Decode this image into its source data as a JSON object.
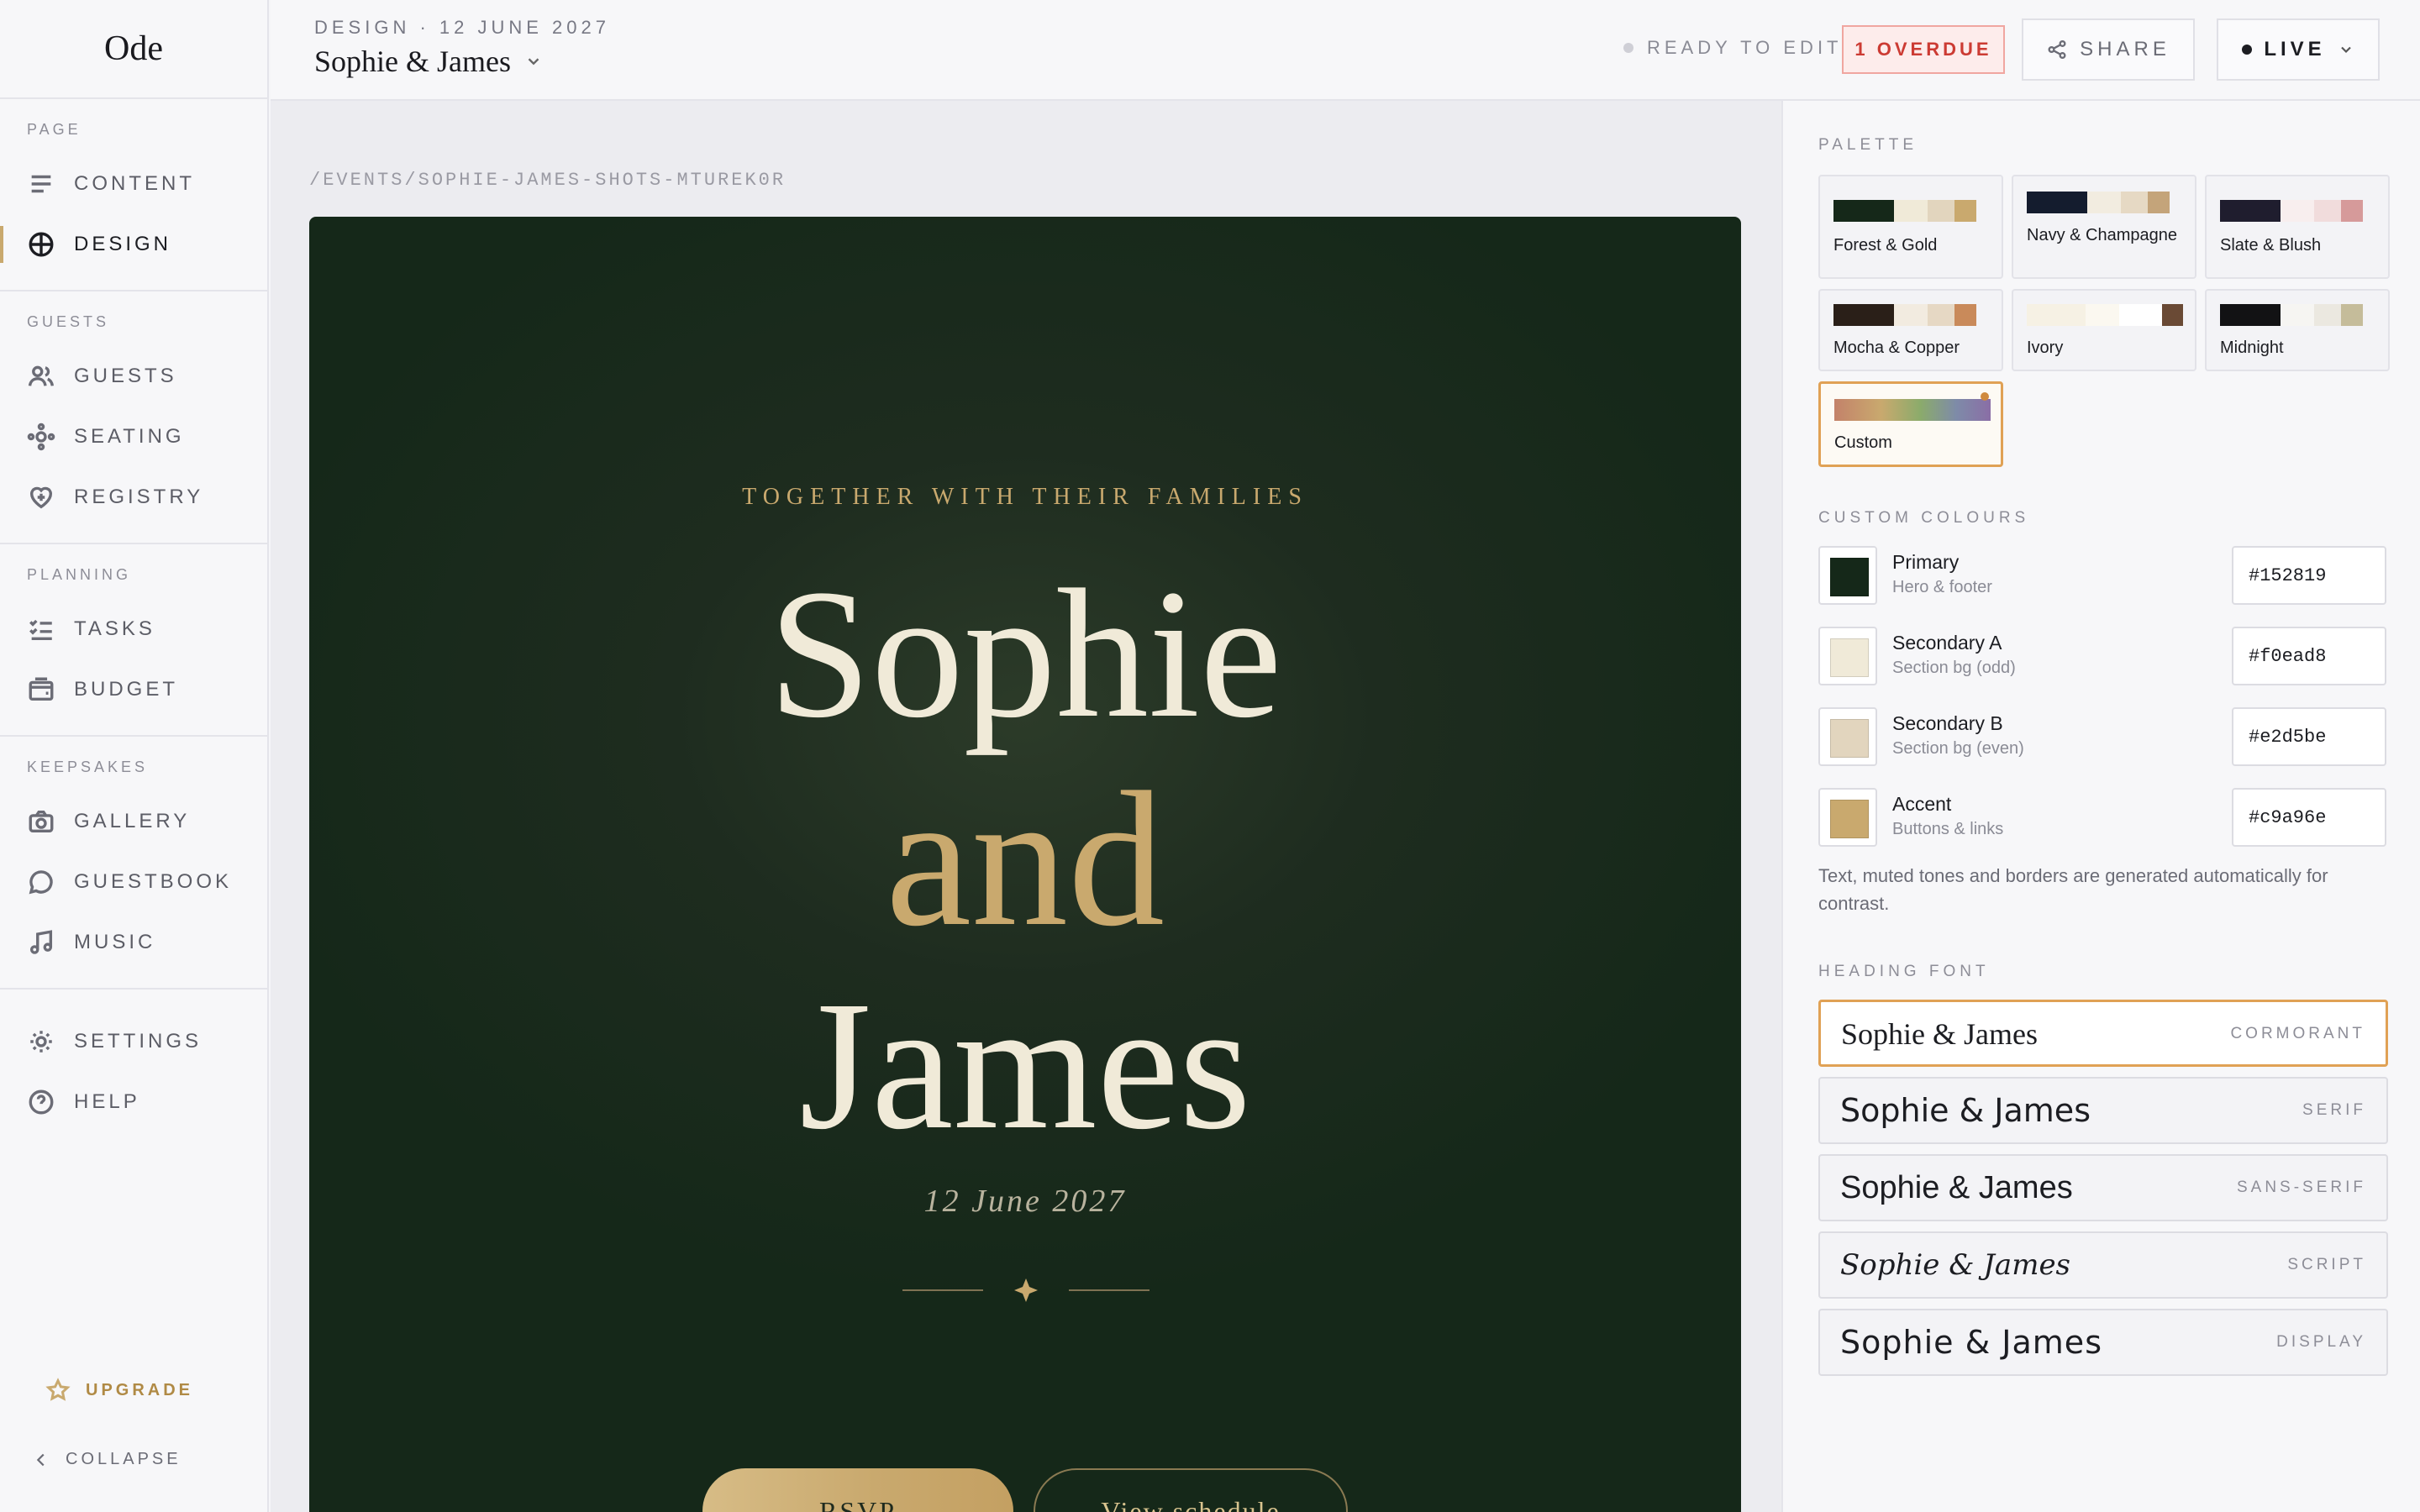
{
  "app": {
    "logo": "Ode"
  },
  "sidebar": {
    "sections": [
      {
        "heading": "PAGE",
        "items": [
          {
            "label": "CONTENT",
            "icon": "content-lines-icon"
          },
          {
            "label": "DESIGN",
            "icon": "globe-icon",
            "active": true
          }
        ]
      },
      {
        "heading": "GUESTS",
        "items": [
          {
            "label": "GUESTS",
            "icon": "people-icon"
          },
          {
            "label": "SEATING",
            "icon": "seating-icon"
          },
          {
            "label": "REGISTRY",
            "icon": "heart-icon"
          }
        ]
      },
      {
        "heading": "PLANNING",
        "items": [
          {
            "label": "TASKS",
            "icon": "checklist-icon"
          },
          {
            "label": "BUDGET",
            "icon": "wallet-icon"
          }
        ]
      },
      {
        "heading": "KEEPSAKES",
        "items": [
          {
            "label": "GALLERY",
            "icon": "camera-icon"
          },
          {
            "label": "GUESTBOOK",
            "icon": "chat-bubble-icon"
          },
          {
            "label": "MUSIC",
            "icon": "music-note-icon"
          }
        ]
      },
      {
        "heading": "",
        "items": [
          {
            "label": "SETTINGS",
            "icon": "sun-gear-icon"
          },
          {
            "label": "HELP",
            "icon": "help-circle-icon"
          }
        ]
      }
    ],
    "upgrade_label": "UPGRADE",
    "collapse_label": "COLLAPSE"
  },
  "header": {
    "breadcrumb": "DESIGN · 12 JUNE 2027",
    "event_title": "Sophie & James",
    "ready_label": "READY TO EDIT",
    "overdue_label": "1 OVERDUE",
    "share_label": "SHARE",
    "live_label": "LIVE"
  },
  "canvas": {
    "path": "/EVENTS/SOPHIE-JAMES-SHOTS-MTUREK0R",
    "hero": {
      "kicker": "TOGETHER WITH THEIR FAMILIES",
      "first_name": "Sophie",
      "conjunction": "and",
      "second_name": "James",
      "date": "12 June 2027",
      "rsvp_label": "RSVP",
      "schedule_label": "View schedule"
    }
  },
  "panel": {
    "palette_heading": "PALETTE",
    "palettes": [
      {
        "name": "Forest & Gold",
        "colors": [
          "#152819",
          "#f0ead8",
          "#e2d5be",
          "#c9a96e"
        ]
      },
      {
        "name": "Navy & Champagne",
        "colors": [
          "#141c2e",
          "#f2ece0",
          "#e6d9c4",
          "#c4a47a"
        ]
      },
      {
        "name": "Slate & Blush",
        "colors": [
          "#1f1d2e",
          "#f8eeee",
          "#f1dcdc",
          "#d69a9a"
        ]
      },
      {
        "name": "Mocha & Copper",
        "colors": [
          "#2a1f18",
          "#f2ebe0",
          "#e6d8c4",
          "#c98a5a"
        ]
      },
      {
        "name": "Ivory",
        "colors": [
          "#f6f1e4",
          "#fbf8f0",
          "#ffffff",
          "#6a4a35"
        ]
      },
      {
        "name": "Midnight",
        "colors": [
          "#121214",
          "#f6f5f2",
          "#ebe8e0",
          "#c5bc9a"
        ]
      },
      {
        "name": "Custom",
        "colors": [],
        "selected": true
      }
    ],
    "custom_heading": "CUSTOM COLOURS",
    "custom_colours": [
      {
        "label": "Primary",
        "sub": "Hero & footer",
        "hex": "#152819"
      },
      {
        "label": "Secondary A",
        "sub": "Section bg (odd)",
        "hex": "#f0ead8"
      },
      {
        "label": "Secondary B",
        "sub": "Section bg (even)",
        "hex": "#e2d5be"
      },
      {
        "label": "Accent",
        "sub": "Buttons & links",
        "hex": "#c9a96e"
      }
    ],
    "custom_note": "Text, muted tones and borders are generated automatically for contrast.",
    "font_heading": "HEADING FONT",
    "fonts": [
      {
        "sample": "Sophie & James",
        "tag": "CORMORANT",
        "selected": true
      },
      {
        "sample": "Sophie & James",
        "tag": "SERIF"
      },
      {
        "sample": "Sophie & James",
        "tag": "SANS-SERIF"
      },
      {
        "sample": "Sophie & James",
        "tag": "SCRIPT"
      },
      {
        "sample": "Sophie & James",
        "tag": "DISPLAY"
      }
    ]
  }
}
